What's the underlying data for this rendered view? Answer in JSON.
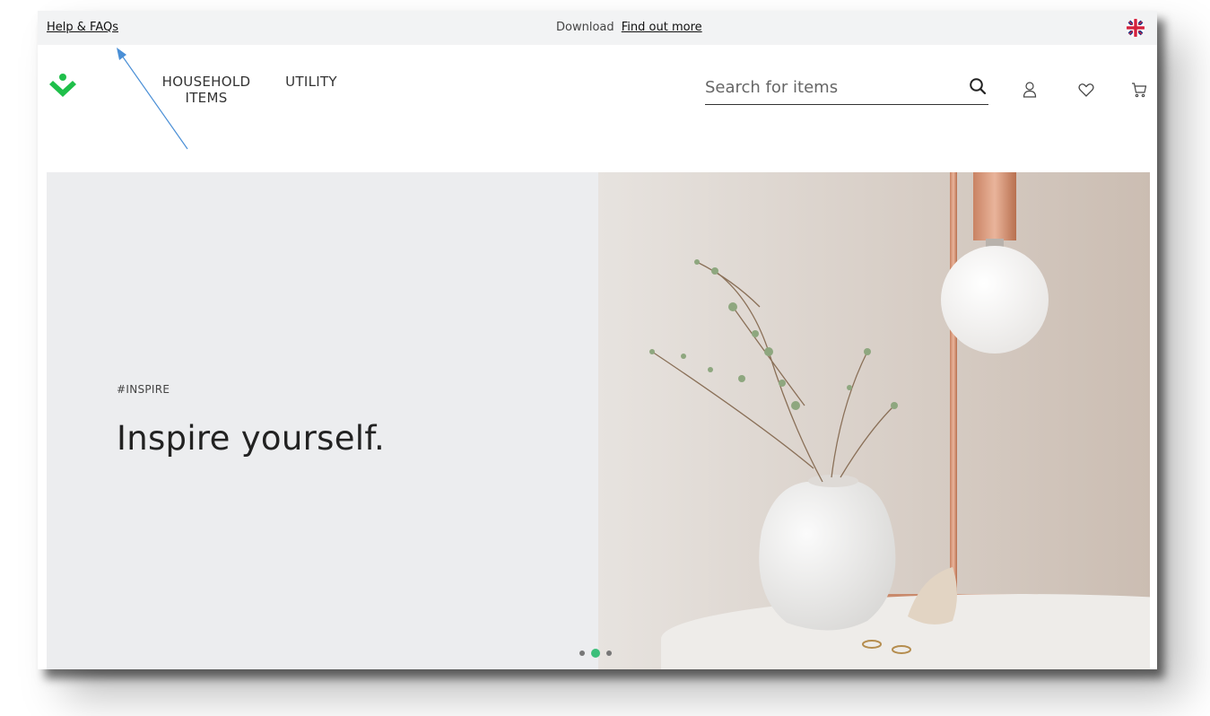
{
  "topbar": {
    "help_link": "Help & FAQs",
    "download_text": "Download",
    "find_out_more": "Find out more",
    "language_icon": "uk-flag-icon"
  },
  "header": {
    "logo_icon": "brand-chevron-logo-icon",
    "nav": [
      {
        "label_line1": "HOUSEHOLD",
        "label_line2": "ITEMS"
      },
      {
        "label_line1": "UTILITY",
        "label_line2": ""
      }
    ],
    "search": {
      "placeholder": "Search for items",
      "value": "",
      "icon": "search-icon"
    },
    "icons": [
      "user-icon",
      "heart-icon",
      "cart-icon"
    ]
  },
  "hero": {
    "tag": "#INSPIRE",
    "title": "Inspire yourself.",
    "image": "white-vase-with-branch-and-copper-lamp",
    "carousel": {
      "count": 3,
      "active_index": 1
    }
  },
  "colors": {
    "accent": "#1fbf4a",
    "active_dot": "#3cbf7a",
    "topbar_bg": "#f2f3f4",
    "hero_bg": "#ecedef",
    "annotation_arrow": "#4a8fd6"
  }
}
